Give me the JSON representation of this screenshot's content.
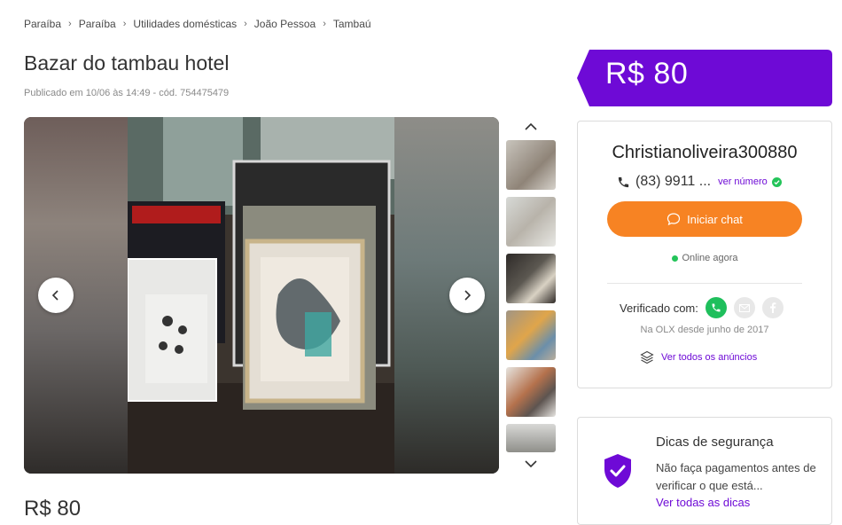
{
  "breadcrumb": [
    "Paraíba",
    "Paraíba",
    "Utilidades domésticas",
    "João Pessoa",
    "Tambaú"
  ],
  "title": "Bazar do tambau hotel",
  "meta": "Publicado em 10/06 às 14:49 - cód. 754475479",
  "price": "R$ 80",
  "bottom_price": "R$ 80",
  "seller": {
    "name": "Christianoliveira300880",
    "phone": "(83) 9911 ...",
    "ver_numero": "ver número",
    "chat_button": "Iniciar chat",
    "online": "Online agora",
    "verified_label": "Verificado com:",
    "since": "Na OLX desde junho de 2017",
    "all_ads": "Ver todos os anúncios"
  },
  "safety": {
    "title": "Dicas de segurança",
    "text": "Não faça pagamentos antes de verificar o que está...",
    "link": "Ver todas as dicas"
  },
  "gallery": {
    "thumbnail_count": 6,
    "selected_thumbnail": 3
  },
  "colors": {
    "brand_purple": "#6e0ad6",
    "chat_orange": "#f78323",
    "online_green": "#24c45a",
    "whatsapp_green": "#1fbf5c"
  },
  "icons": [
    "chevron-right-icon",
    "arrow-left-icon",
    "arrow-right-icon",
    "chevron-up-icon",
    "chevron-down-icon",
    "phone-icon",
    "check-circle-icon",
    "chat-bubble-icon",
    "whatsapp-icon",
    "email-icon",
    "facebook-icon",
    "layers-icon",
    "shield-check-icon"
  ]
}
